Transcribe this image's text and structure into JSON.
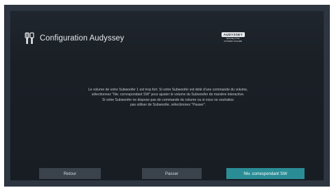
{
  "header": {
    "title": "Configuration Audyssey",
    "icon": "speaker-icon"
  },
  "logo": {
    "brand": "AUDYSSEY",
    "subtitle_line1": "MULTEQ XT32",
    "subtitle_line2": "DYNAMIC VOLUME"
  },
  "message": {
    "lines": [
      "Le volume de votre Subwoofer 1 est trop fort. Si votre Subwoofer est doté d'une commande du volume,",
      "sélectionnez \"Niv. correspondant SW\" pour ajuster le volume du Subwoofer de manière interactive.",
      "Si votre Subwoofer ne dispose pas de commande du volume ou si vous ne souhaitez",
      "pas utiliser de Subwoofer, sélectionnez \"Passer\"."
    ]
  },
  "buttons": {
    "back_label": "Retour",
    "skip_label": "Passer",
    "sw_level_label": "Niv. correspondant SW",
    "active_color": "#2a8d96"
  }
}
